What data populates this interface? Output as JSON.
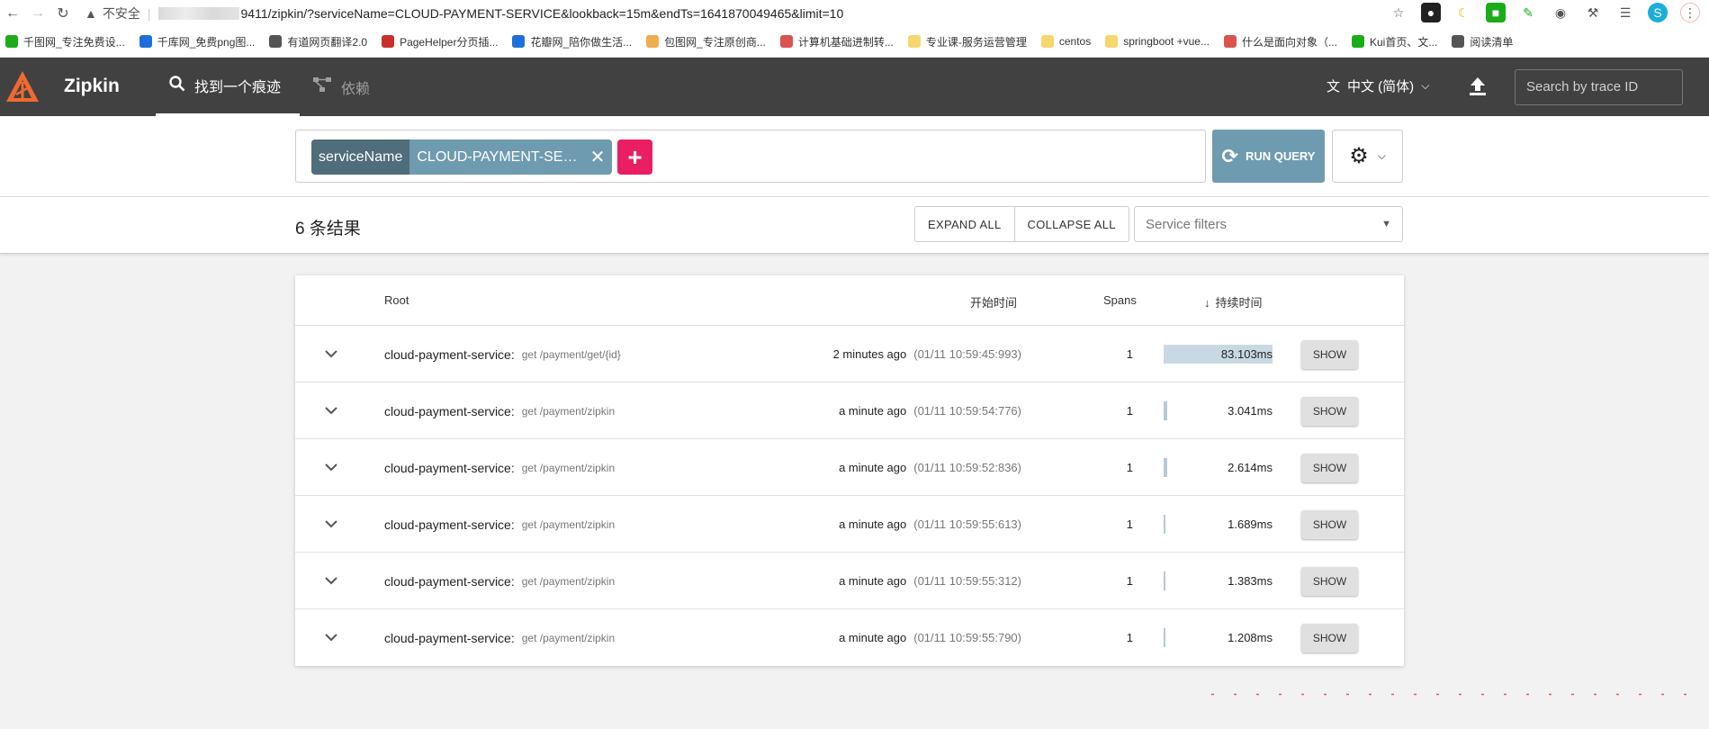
{
  "browser": {
    "security_label": "不安全",
    "url_visible": "9411/zipkin/?serviceName=CLOUD-PAYMENT-SERVICE&lookback=15m&endTs=1641870049465&limit=10",
    "bookmarks": [
      {
        "label": "千图网_专注免费设...",
        "color": "#1aad19"
      },
      {
        "label": "千库网_免费png图...",
        "color": "#1e6fd9"
      },
      {
        "label": "有道网页翻译2.0",
        "color": "#555555"
      },
      {
        "label": "PageHelper分页插...",
        "color": "#c9302c"
      },
      {
        "label": "花瓣网_陪你做生活...",
        "color": "#1e6fd9"
      },
      {
        "label": "包图网_专注原创商...",
        "color": "#f0ad4e"
      },
      {
        "label": "计算机基础进制转...",
        "color": "#d9534f"
      },
      {
        "label": "专业课-服务运营管理",
        "color": "#f5d76e"
      },
      {
        "label": "centos",
        "color": "#f5d76e"
      },
      {
        "label": "springboot +vue...",
        "color": "#f5d76e"
      },
      {
        "label": "什么是面向对象（...",
        "color": "#d9534f"
      },
      {
        "label": "Kui首页、文...",
        "color": "#1aad19"
      },
      {
        "label": "阅读清单",
        "color": "#555555"
      }
    ]
  },
  "header": {
    "brand": "Zipkin",
    "tabs": [
      {
        "label": "找到一个痕迹",
        "active": true
      },
      {
        "label": "依赖",
        "active": false
      }
    ],
    "language": "中文 (简体)",
    "search_placeholder": "Search by trace ID"
  },
  "query": {
    "chip_key": "serviceName",
    "chip_value": "CLOUD-PAYMENT-SERVICE",
    "run_label": "RUN QUERY"
  },
  "results": {
    "count_label": "6 条结果",
    "expand_all": "EXPAND ALL",
    "collapse_all": "COLLAPSE ALL",
    "service_filters_placeholder": "Service filters"
  },
  "table": {
    "headers": {
      "root": "Root",
      "start_time": "开始时间",
      "spans": "Spans",
      "duration": "持续时间"
    },
    "show_label": "SHOW",
    "rows": [
      {
        "service": "cloud-payment-service:",
        "path": "get /payment/get/{id}",
        "ago": "2 minutes ago",
        "abs": "(01/11 10:59:45:993)",
        "spans": "1",
        "duration": "83.103ms",
        "fraction": 1.0
      },
      {
        "service": "cloud-payment-service:",
        "path": "get /payment/zipkin",
        "ago": "a minute ago",
        "abs": "(01/11 10:59:54:776)",
        "spans": "1",
        "duration": "3.041ms",
        "fraction": 0.0366
      },
      {
        "service": "cloud-payment-service:",
        "path": "get /payment/zipkin",
        "ago": "a minute ago",
        "abs": "(01/11 10:59:52:836)",
        "spans": "1",
        "duration": "2.614ms",
        "fraction": 0.0315
      },
      {
        "service": "cloud-payment-service:",
        "path": "get /payment/zipkin",
        "ago": "a minute ago",
        "abs": "(01/11 10:59:55:613)",
        "spans": "1",
        "duration": "1.689ms",
        "fraction": 0.0203
      },
      {
        "service": "cloud-payment-service:",
        "path": "get /payment/zipkin",
        "ago": "a minute ago",
        "abs": "(01/11 10:59:55:312)",
        "spans": "1",
        "duration": "1.383ms",
        "fraction": 0.0166
      },
      {
        "service": "cloud-payment-service:",
        "path": "get /payment/zipkin",
        "ago": "a minute ago",
        "abs": "(01/11 10:59:55:790)",
        "spans": "1",
        "duration": "1.208ms",
        "fraction": 0.0145
      }
    ]
  },
  "colors": {
    "header_bg": "#414141",
    "accent_teal": "#6f9bb0",
    "chip_key_bg": "#4f6d7a",
    "add_button": "#e91e63",
    "duration_bar": "#c9d9e3"
  }
}
